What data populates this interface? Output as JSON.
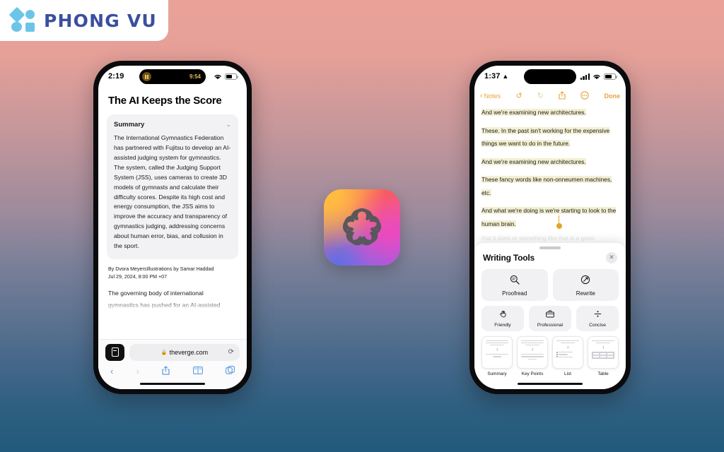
{
  "brand": {
    "name": "PHONG VU",
    "accent_blue": "#6cc5e8",
    "text_color": "#3a4fa0"
  },
  "background": {
    "gradient_top": "#eaa298",
    "gradient_mid": "#7c8099",
    "gradient_bottom": "#215a7d"
  },
  "center_icon": {
    "name": "apple-intelligence-icon",
    "label": "Apple Intelligence"
  },
  "phone_left": {
    "status": {
      "time": "2:19",
      "island_time": "9:54",
      "island_activity": "pause",
      "wifi": "wifi-icon",
      "battery": "battery-icon"
    },
    "article": {
      "title": "The AI Keeps the Score",
      "summary_label": "Summary",
      "summary_chevron": "⌄",
      "summary_text": "The International Gymnastics Federation has partnered with Fujitsu to develop an AI-assisted judging system for gymnastics. The system, called the Judging Support System (JSS), uses cameras to create 3D models of gymnasts and calculate their difficulty scores. Despite its high cost and energy consumption, the JSS aims to improve the accuracy and transparency of gymnastics judging, addressing concerns about human error, bias, and collusion in the sport.",
      "byline": "By Dvora MeyersIllustrations by Samar Haddad",
      "date": "Jul 29, 2024, 8:00 PM +07",
      "paragraph": "The governing body of international",
      "paragraph_cut": "gymnastics has pushed for an AI-assisted"
    },
    "browser": {
      "lock": "🔒",
      "url": "theverge.com",
      "reload": "⟳",
      "tabs_chip": "reader-icon",
      "back": "‹",
      "forward": "›",
      "share": "share-icon",
      "bookmarks": "book-icon",
      "tabs": "tabs-icon"
    }
  },
  "phone_right": {
    "status": {
      "time": "1:37",
      "person": "▲",
      "cell": "cellular-icon",
      "wifi": "wifi-icon",
      "battery": "battery-icon"
    },
    "nav": {
      "back_chevron": "‹",
      "back_label": "Notes",
      "undo": "↺",
      "redo": "↻",
      "share": "share-icon",
      "more": "more-icon",
      "done": "Done"
    },
    "note": {
      "paragraphs": [
        "And we're examining new architectures.",
        "These. In the past isn't working for the expensive things we want to do in the future.",
        "And we're examining new architectures.",
        "These fancy words like non-onneumen machines, etc.",
        "And what we're doing is we're starting to look to the human brain."
      ],
      "ghost_line": "that it does or something like that is a great"
    },
    "writing_tools": {
      "title": "Writing Tools",
      "close": "✕",
      "primary": [
        {
          "label": "Proofread",
          "icon": "magnifier-icon",
          "glyph": "⌕"
        },
        {
          "label": "Rewrite",
          "icon": "rewrite-circular-arrow-icon",
          "glyph": "⟳"
        }
      ],
      "tones": [
        {
          "label": "Friendly",
          "icon": "wave-hand-icon",
          "glyph": "✋"
        },
        {
          "label": "Professional",
          "icon": "briefcase-icon",
          "glyph": "💼"
        },
        {
          "label": "Concise",
          "icon": "divide-icon",
          "glyph": "÷"
        }
      ],
      "formats": [
        {
          "label": "Summary",
          "icon": "summary-card-icon"
        },
        {
          "label": "Key Points",
          "icon": "key-points-card-icon"
        },
        {
          "label": "List",
          "icon": "list-card-icon"
        },
        {
          "label": "Table",
          "icon": "table-card-icon"
        }
      ]
    }
  }
}
